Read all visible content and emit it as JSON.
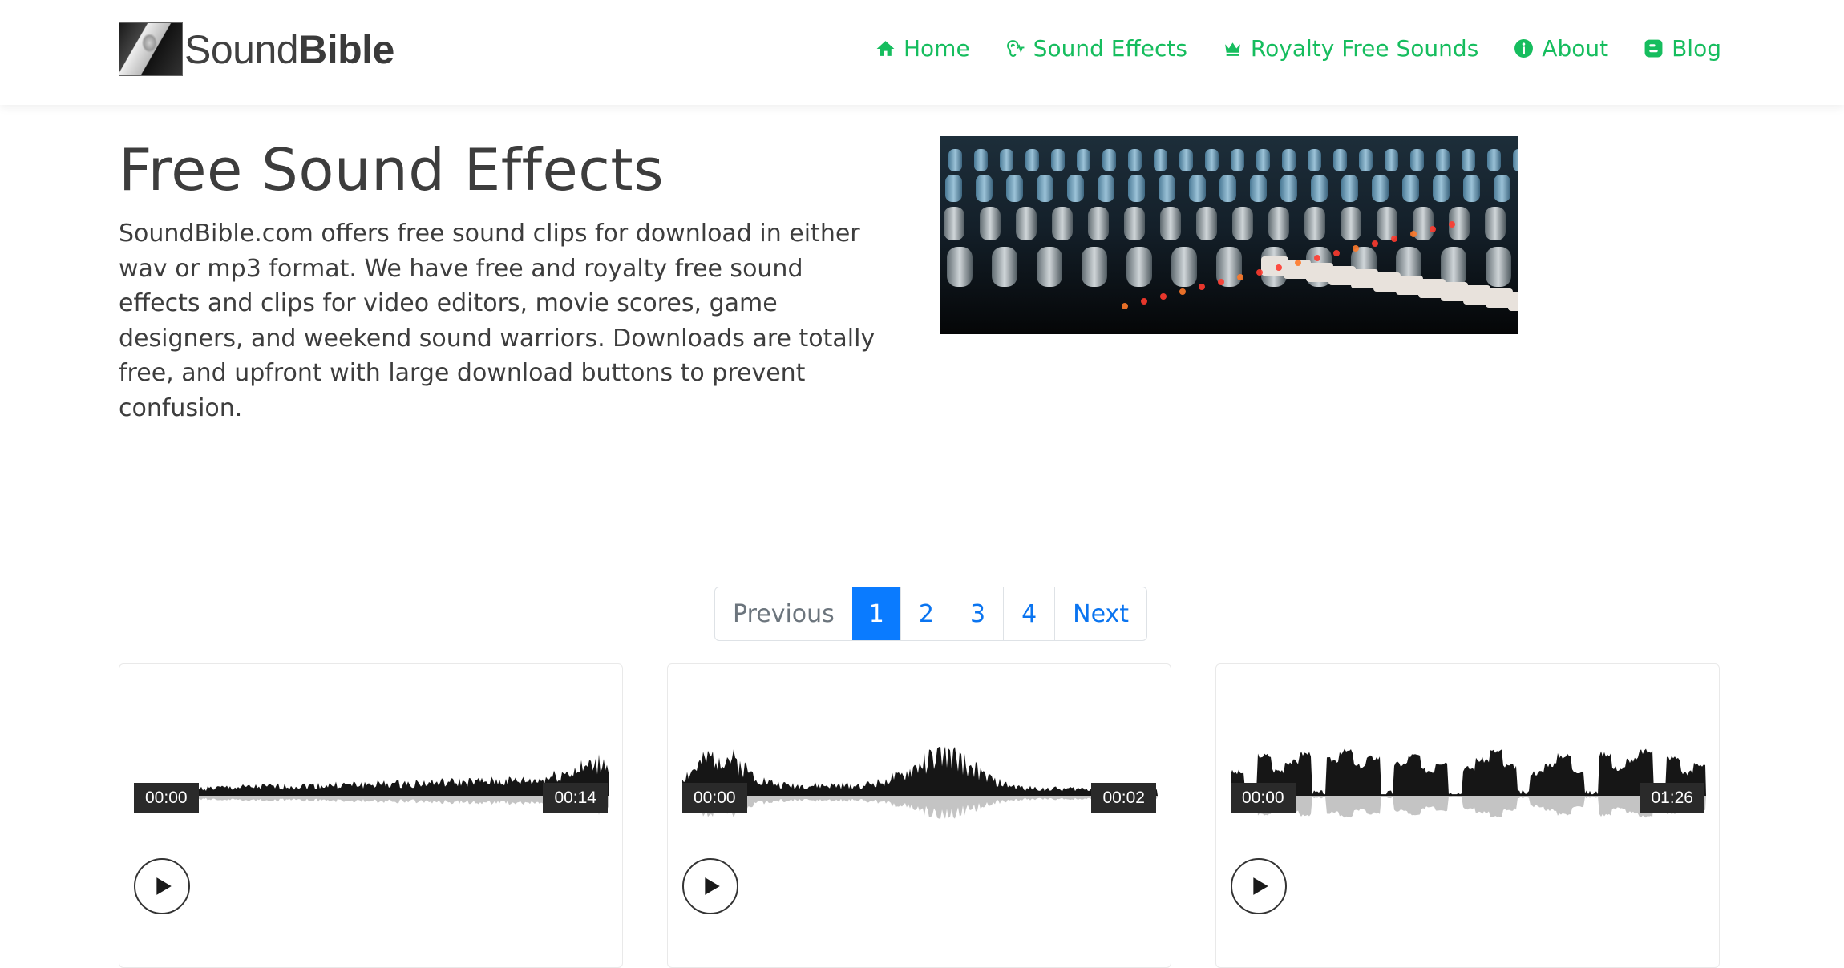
{
  "brand": {
    "name_light": "Sound",
    "name_bold": "Bible"
  },
  "nav": {
    "items": [
      {
        "label": "Home",
        "icon": "home-icon"
      },
      {
        "label": "Sound Effects",
        "icon": "ear-icon"
      },
      {
        "label": "Royalty Free Sounds",
        "icon": "crown-icon"
      },
      {
        "label": "About",
        "icon": "info-icon"
      },
      {
        "label": "Blog",
        "icon": "blogger-icon"
      }
    ],
    "accent_color": "#16bd5e"
  },
  "main": {
    "title": "Free Sound Effects",
    "intro": "SoundBible.com offers free sound clips for download in either wav or mp3 format. We have free and royalty free sound effects and clips for video editors, movie scores, game designers, and weekend sound warriors. Downloads are totally free, and upfront with large download buttons to prevent confusion."
  },
  "pagination": {
    "previous": "Previous",
    "pages": [
      "1",
      "2",
      "3",
      "4"
    ],
    "next": "Next",
    "current": "1",
    "active_color": "#0a7bff"
  },
  "cards": [
    {
      "current_time": "00:00",
      "duration": "00:14"
    },
    {
      "current_time": "00:00",
      "duration": "00:02"
    },
    {
      "current_time": "00:00",
      "duration": "01:26"
    }
  ]
}
